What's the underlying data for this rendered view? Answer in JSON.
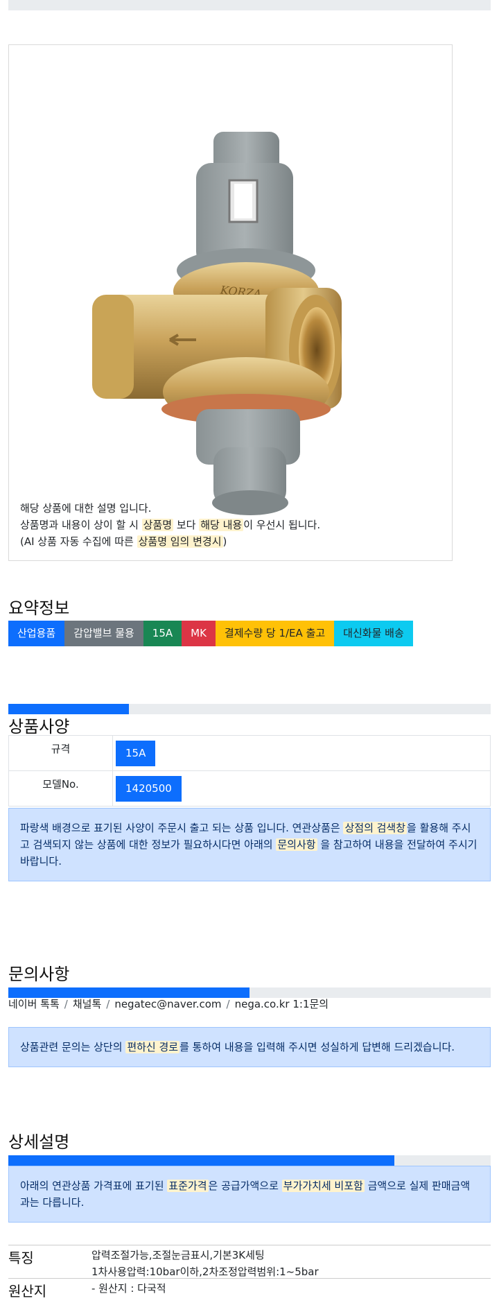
{
  "product": {
    "description_line1": "해당 상품에 대한 설명 입니다.",
    "description_line2": {
      "p1": "상품명과 내용이 상이 할 시",
      "h1": "상품명",
      "p2": "보다",
      "h2": "해당 내용",
      "p3": "이 우선시 됩니다."
    },
    "description_line3": {
      "p1": "(AI 상품 자동 수집에 따른",
      "h1": "상품명 임의 변경시",
      "p2": ")"
    }
  },
  "summary": {
    "title": "요약정보",
    "badges": [
      {
        "label": "산업용품",
        "color": "#0d6efd"
      },
      {
        "label": "감압밸브 물용",
        "color": "#6c757d"
      },
      {
        "label": "15A",
        "color": "#198754"
      },
      {
        "label": "MK",
        "color": "#dc3545"
      },
      {
        "label": "결제수량 당 1/EA 출고",
        "color": "#ffc107"
      },
      {
        "label": "대신화물 배송",
        "color": "#0dcaf0"
      }
    ]
  },
  "spec": {
    "title": "상품사양",
    "progress": 0.25,
    "rows": [
      {
        "key": "규격",
        "value": "15A"
      },
      {
        "key": "모델No.",
        "value": "1420500"
      }
    ],
    "notice": {
      "p1": "파랑색 배경으로 표기된 사양이 주문시 출고 되는 상품 입니다. 연관상품은",
      "h1": "상점의 검색창",
      "p2": "을 활용해 주시고 검색되지 않는 상품에 대한 정보가 필요하시다면 아래의",
      "h2": "문의사항",
      "p3": "을 참고하여 내용을 전달하여 주시기 바랍니다."
    }
  },
  "inquiry": {
    "title": "문의사항",
    "progress": 0.5,
    "links": [
      "네이버 톡톡",
      "채널톡",
      "negatec@naver.com",
      "nega.co.kr 1:1문의"
    ],
    "separator": "/",
    "notice": {
      "p1": "상품관련 문의는 상단의",
      "h1": "편하신 경로",
      "p2": "를 통하여 내용을 입력해 주시면 성실하게 답변해 드리겠습니다."
    }
  },
  "detail": {
    "title": "상세설명",
    "progress": 0.8,
    "notice": {
      "p1": "아래의 연관상품 가격표에 표기된",
      "h1": "표준가격",
      "p2": "은 공급가액으로",
      "h2": "부가가치세 비포함",
      "p3": "금액으로 실제 판매금액과는 다릅니다."
    },
    "features_label": "특징",
    "features_line1": "압력조절가능,조절눈금표시,기본3K세팅",
    "features_line2": "1차사용압력:10bar이하,2차조정압력범위:1~5bar",
    "origin_label": "원산지",
    "origin_value": "- 원산지 : 다국적"
  }
}
